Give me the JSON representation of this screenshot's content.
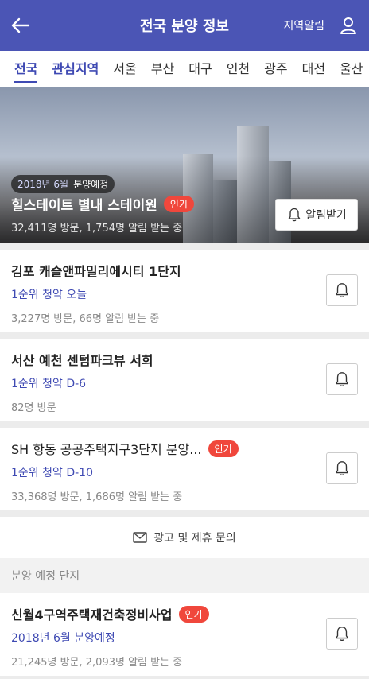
{
  "header": {
    "title": "전국 분양 정보",
    "region_alert": "지역알림"
  },
  "tabs": [
    {
      "label": "전국"
    },
    {
      "label": "관심지역"
    },
    {
      "label": "서울"
    },
    {
      "label": "부산"
    },
    {
      "label": "대구"
    },
    {
      "label": "인천"
    },
    {
      "label": "광주"
    },
    {
      "label": "대전"
    },
    {
      "label": "울산"
    }
  ],
  "hero": {
    "date": "2018년 6월",
    "status": "분양예정",
    "name": "힐스테이트 별내 스테이원",
    "badge": "인기",
    "stats": "32,411명 방문, 1,754명 알림 받는 중",
    "alert_button": "알림받기"
  },
  "listings": [
    {
      "name": "김포 캐슬앤파밀리에시티 1단지",
      "sub": "1순위 청약 오늘",
      "stats": "3,227명 방문, 66명 알림 받는 중"
    },
    {
      "name": "서산 예천 센텀파크뷰 서희",
      "sub": "1순위 청약 D-6",
      "stats": "82명 방문"
    },
    {
      "name": "SH 항동 공공주택지구3단지 분양...",
      "badge": "인기",
      "sub": "1순위 청약 D-10",
      "stats": "33,368명 방문, 1,686명 알림 받는 중"
    }
  ],
  "ad": {
    "label": "광고 및 제휴 문의"
  },
  "section": {
    "title": "분양 예정 단지"
  },
  "upcoming": [
    {
      "name": "신월4구역주택재건축정비사업",
      "badge": "인기",
      "sub": "2018년 6월 분양예정",
      "stats": "21,245명 방문, 2,093명 알림 받는 중"
    }
  ],
  "colors": {
    "primary": "#4b55b5",
    "accent": "#3f4ab3",
    "badge": "#f0473c"
  }
}
